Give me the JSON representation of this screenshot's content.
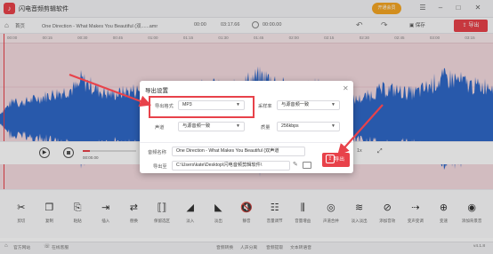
{
  "window": {
    "app_title": "闪电音频剪辑软件",
    "logo_glyph": "♪",
    "member_label": "开通会员",
    "controls": [
      "☰",
      "–",
      "□",
      "✕"
    ]
  },
  "toolbar": {
    "home_label": "首页",
    "file_name": "One Direction - What Makes You Beautiful (双......amr",
    "current_time": "00:00",
    "total_time": "03:17.66",
    "position_time": "00:00.00",
    "save_label": "保存",
    "export_label": "导出"
  },
  "ruler": {
    "labels": [
      "00:00",
      "00:15",
      "00:30",
      "00:45",
      "01:00",
      "01:15",
      "01:30",
      "01:45",
      "02:00",
      "02:15",
      "02:30",
      "02:45",
      "03:00",
      "03:15"
    ]
  },
  "transport": {
    "elapsed": "00:00.00",
    "duration": "03:17.66",
    "zoom_level": "1x",
    "progress": 0.13
  },
  "tools": [
    {
      "icon": "scissors-icon",
      "glyph": "✂",
      "label": "剪切"
    },
    {
      "icon": "copy-icon",
      "glyph": "❐",
      "label": "复制"
    },
    {
      "icon": "paste-icon",
      "glyph": "⎘",
      "label": "粘贴"
    },
    {
      "icon": "insert-icon",
      "glyph": "⇥",
      "label": "插入"
    },
    {
      "icon": "replace-icon",
      "glyph": "⇄",
      "label": "替换"
    },
    {
      "icon": "keep-icon",
      "glyph": "⟦⟧",
      "label": "保留选区"
    },
    {
      "icon": "fade-in-icon",
      "glyph": "◢",
      "label": "淡入"
    },
    {
      "icon": "fade-out-icon",
      "glyph": "◣",
      "label": "淡出"
    },
    {
      "icon": "mute-icon",
      "glyph": "🔇",
      "label": "静音"
    },
    {
      "icon": "volume-icon",
      "glyph": "☷",
      "label": "音量调节"
    },
    {
      "icon": "equalizer-icon",
      "glyph": "⫼",
      "label": "音量增益"
    },
    {
      "icon": "echo-icon",
      "glyph": "◎",
      "label": "声道合并"
    },
    {
      "icon": "noise-icon",
      "glyph": "≋",
      "label": "淡入淡出"
    },
    {
      "icon": "split-icon",
      "glyph": "⊘",
      "label": "添加音效"
    },
    {
      "icon": "mix-icon",
      "glyph": "⇢",
      "label": "变声变调"
    },
    {
      "icon": "speed-icon",
      "glyph": "⊕",
      "label": "变速"
    },
    {
      "icon": "record-icon",
      "glyph": "◉",
      "label": "添加背景音"
    }
  ],
  "statusbar": {
    "left": [
      "官方网站",
      "在线客服"
    ],
    "center": [
      "音频转换",
      "人声分离",
      "音频提取",
      "文本转语音"
    ],
    "version": "v4.1.8"
  },
  "dialog": {
    "title": "导出设置",
    "close": "✕",
    "format_label": "导出格式",
    "format_value": "MP3",
    "sample_rate_label": "采样率",
    "sample_rate_value": "与源音频一致",
    "channel_label": "声道",
    "channel_value": "与源音频一致",
    "quality_label": "质量",
    "quality_value": "256kbps",
    "name_label": "音频名称",
    "name_value": "One Direction - What Makes You Beautiful (双声道",
    "path_label": "导出至",
    "path_value": "C:\\Users\\kate\\Desktop\\闪电音频剪辑软件\\",
    "export_label": "导出",
    "export_icon": "⇪"
  },
  "colors": {
    "accent": "#e8424a",
    "waveform": "#2f68c8",
    "wave_bg": "#f5dbe0",
    "annotation": "#e8424a"
  }
}
